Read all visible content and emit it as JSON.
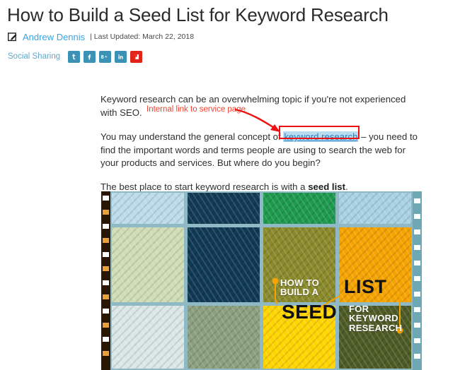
{
  "article": {
    "title": "How to Build a Seed List for Keyword Research",
    "author": "Andrew Dennis",
    "updated": "| Last Updated: March 22, 2018",
    "edit_icon": "edit-pencil-icon"
  },
  "social": {
    "label": "Social Sharing",
    "buttons": [
      {
        "name": "twitter",
        "glyph": "t",
        "color": "#3b92b5"
      },
      {
        "name": "facebook",
        "glyph": "f",
        "color": "#3b92b5"
      },
      {
        "name": "googleplus",
        "glyph": "8+",
        "color": "#3b92b5"
      },
      {
        "name": "linkedin",
        "glyph": "in",
        "color": "#3b92b5"
      },
      {
        "name": "flipboard",
        "glyph": "F",
        "color": "#e2231a"
      }
    ]
  },
  "body": {
    "p1_a": "Keyword research can be an overwhelming topic if you're not experienced",
    "p1_b": "with SEO.",
    "p2_a": "You may understand the general concept of ",
    "p2_link": "keyword research",
    "p2_b": " – you need to find the important words and terms people are using to search the web for your products and services. But where do you begin?",
    "p3_a": "The best place to start keyword research is with a ",
    "p3_bold": "seed list",
    "p3_b": "."
  },
  "annotation": {
    "text": "Internal link to service page",
    "color": "#f4402c"
  },
  "figure": {
    "alt": "seed-list-infographic",
    "overlay": {
      "how_to": "HOW TO",
      "build_a": "BUILD A",
      "list": "LIST",
      "seed": "SEED",
      "for": "FOR",
      "keyword": "KEYWORD",
      "research": "RESEARCH"
    },
    "cells": [
      {
        "name": "cell-r1c1",
        "color": "#bcdcea"
      },
      {
        "name": "cell-r1c2",
        "color": "#123a55"
      },
      {
        "name": "cell-r1c3",
        "color": "#1e9a4e"
      },
      {
        "name": "cell-r1c4",
        "color": "#a8d2e4"
      },
      {
        "name": "cell-r2c1",
        "color": "#cfddb4"
      },
      {
        "name": "cell-r2c2",
        "color": "#0f3954"
      },
      {
        "name": "cell-r2c3",
        "color": "#8a8a2c"
      },
      {
        "name": "cell-r2c4",
        "color": "#f5a300"
      },
      {
        "name": "cell-r3c1",
        "color": "#dbe7e6"
      },
      {
        "name": "cell-r3c2",
        "color": "#8aa07e"
      },
      {
        "name": "cell-r3c3",
        "color": "#ffd400"
      },
      {
        "name": "cell-r3c4",
        "color": "#4d5b25"
      }
    ]
  }
}
